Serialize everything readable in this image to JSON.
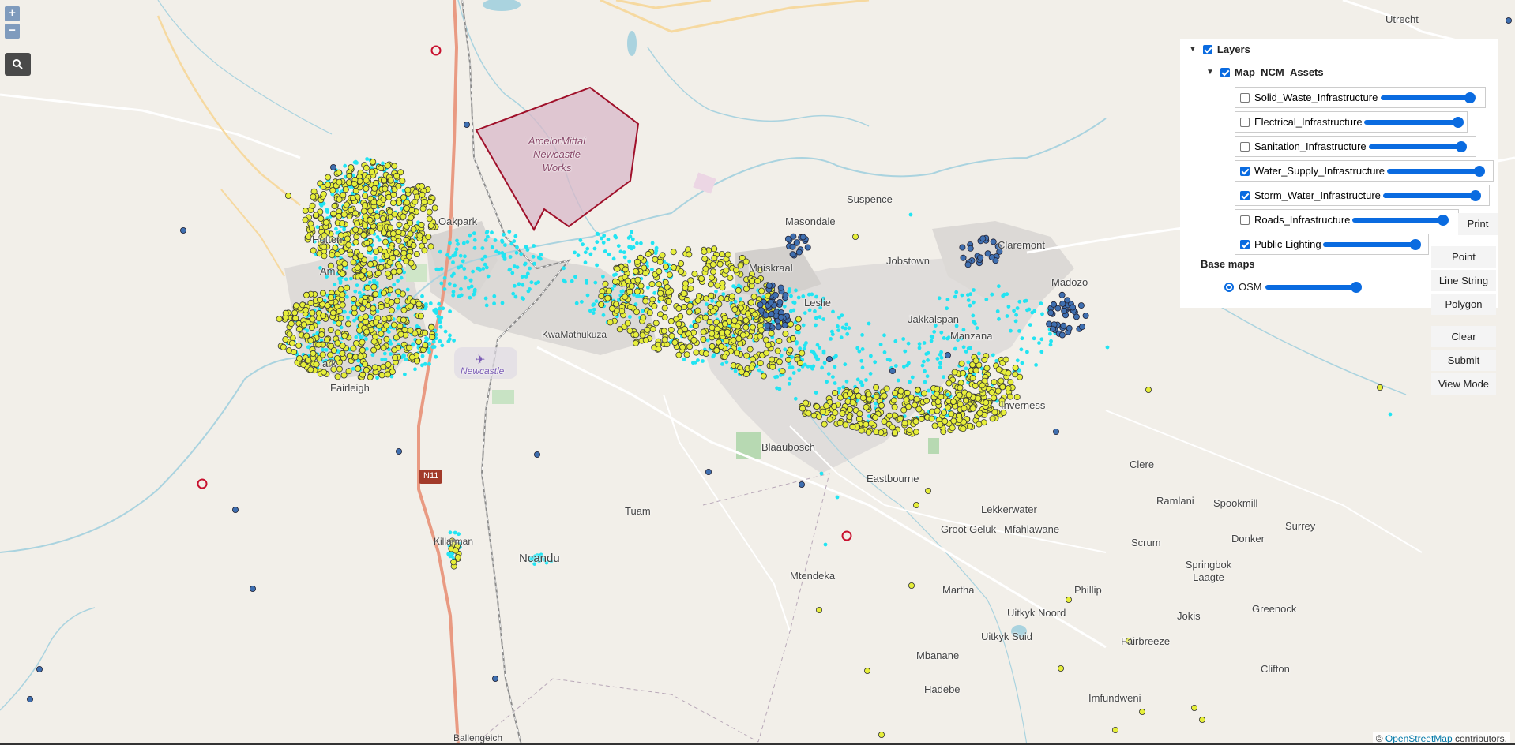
{
  "map": {
    "labels": {
      "arcelor": "ArcelorMittal Newcastle Works",
      "newcastle_airport": "Newcastle",
      "utrecht": "Utrecht",
      "masondale": "Masondale",
      "suspence": "Suspence",
      "claremont": "Claremont",
      "jobstown": "Jobstown",
      "muiskraal": "Muiskraal",
      "leslie": "Leslie",
      "jakkalspan": "Jakkalspan",
      "madozo": "Madozo",
      "manzana": "Manzana",
      "kwamathukuza": "KwaMathukuza",
      "blaaubosch": "Blaaubosch",
      "eastbourne": "Eastbourne",
      "inverness": "Inverness",
      "tuam": "Tuam",
      "clere": "Clere",
      "ramlani": "Ramlani",
      "spookmill": "Spookmill",
      "surrey": "Surrey",
      "lekkerwater": "Lekkerwater",
      "groot_geluk": "Groot Geluk",
      "mfahlawane": "Mfahlawane",
      "scrum": "Scrum",
      "donker": "Donker",
      "springbok_laagte": "Springbok Laagte",
      "mtendeka": "Mtendeka",
      "martha": "Martha",
      "phillip": "Phillip",
      "greenock": "Greenock",
      "uitkyk_noord": "Uitkyk Noord",
      "jokis": "Jokis",
      "uitkyk_suid": "Uitkyk Suid",
      "fairbreeze": "Fairbreeze",
      "mbanane": "Mbanane",
      "clifton": "Clifton",
      "hadebe": "Hadebe",
      "imfundweni": "Imfundweni",
      "ballengeich": "Ballengeich",
      "killarman": "Killarman",
      "ncandu": "Ncandu",
      "n11": "N11",
      "hutten": "Hutten",
      "fairleigh": "Fairleigh",
      "amiel": "Am",
      "ark": "ark",
      "oakpark": "Oakpark"
    },
    "colors": {
      "background": "#f2efe9",
      "cyan_points": "#22e4f2",
      "yellow_points": "#e6ee3a",
      "blue_points": "#3f6fb0",
      "red_markers": "#c8102e",
      "arcelor_fill": "#d8b8c8",
      "arcelor_stroke": "#a0102a"
    }
  },
  "zoom": {
    "in_label": "+",
    "out_label": "−"
  },
  "search": {
    "icon": "search-icon"
  },
  "layers": {
    "root_label": "Layers",
    "group_label": "Map_NCM_Assets",
    "items": [
      {
        "label": "Solid_Waste_Infrastructure",
        "checked": false
      },
      {
        "label": "Electrical_Infrastructure",
        "checked": false
      },
      {
        "label": "Sanitation_Infrastructure",
        "checked": false
      },
      {
        "label": "Water_Supply_Infrastructure",
        "checked": true
      },
      {
        "label": "Storm_Water_Infrastructure",
        "checked": true
      },
      {
        "label": "Roads_Infrastructure",
        "checked": false
      },
      {
        "label": "Public Lighting",
        "checked": true
      }
    ],
    "basemaps_label": "Base maps",
    "osm_label": "OSM"
  },
  "tools": {
    "print": "Print",
    "point": "Point",
    "line_string": "Line String",
    "polygon": "Polygon",
    "clear": "Clear",
    "submit": "Submit",
    "view_mode": "View Mode"
  },
  "attribution": {
    "symbol": "©",
    "link": "OpenStreetMap",
    "suffix": " contributors."
  }
}
